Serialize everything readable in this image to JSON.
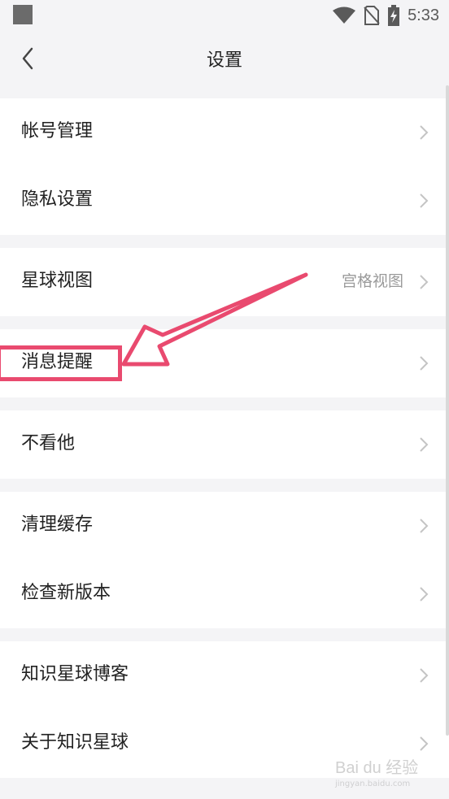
{
  "status_bar": {
    "time": "5:33",
    "icons": [
      "app-notification-icon",
      "wifi-icon",
      "no-sim-icon",
      "battery-charging-icon"
    ]
  },
  "nav": {
    "title": "设置",
    "back_icon": "chevron-left-icon"
  },
  "groups": [
    {
      "items": [
        {
          "label": "帐号管理"
        },
        {
          "label": "隐私设置"
        }
      ]
    },
    {
      "items": [
        {
          "label": "星球视图",
          "value": "宫格视图"
        }
      ]
    },
    {
      "items": [
        {
          "label": "消息提醒",
          "highlighted": true
        }
      ]
    },
    {
      "items": [
        {
          "label": "不看他"
        }
      ]
    },
    {
      "items": [
        {
          "label": "清理缓存"
        },
        {
          "label": "检查新版本"
        }
      ]
    },
    {
      "items": [
        {
          "label": "知识星球博客"
        },
        {
          "label": "关于知识星球"
        }
      ]
    }
  ],
  "annotation": {
    "color": "#e94a6f",
    "target": "消息提醒"
  },
  "watermark": {
    "brand": "Bai du 经验",
    "sub": "jingyan.baidu.com"
  }
}
